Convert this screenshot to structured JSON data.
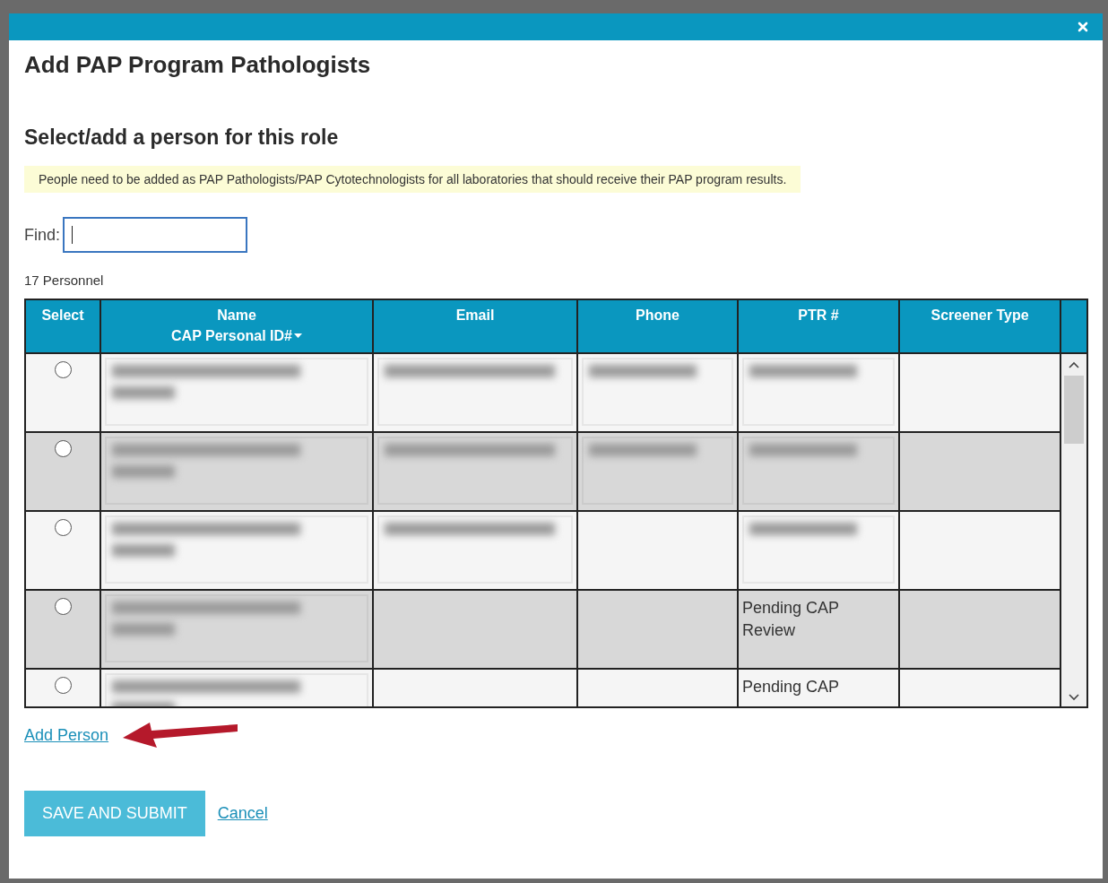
{
  "dialog": {
    "title": "Add PAP Program Pathologists"
  },
  "section_heading": "Select/add a person for this role",
  "notice": "People need to be added as PAP Pathologists/PAP Cytotechnologists for all laboratories that should receive their PAP program results.",
  "find": {
    "label": "Find:",
    "focused": true
  },
  "count": "17 Personnel",
  "table": {
    "columns": [
      {
        "label": "Select"
      },
      {
        "label": "Name",
        "sublabel": "CAP Personal ID#",
        "sorted": true
      },
      {
        "label": "Email"
      },
      {
        "label": "Phone"
      },
      {
        "label": "PTR #"
      },
      {
        "label": "Screener Type"
      }
    ],
    "rows": [
      {
        "selected": false,
        "cells": [
          {
            "kind": "redacted"
          },
          {
            "kind": "redacted"
          },
          {
            "kind": "redacted"
          },
          {
            "kind": "redacted"
          },
          null
        ]
      },
      {
        "selected": false,
        "cells": [
          {
            "kind": "redacted"
          },
          {
            "kind": "redacted"
          },
          {
            "kind": "redacted"
          },
          {
            "kind": "redacted"
          },
          null
        ]
      },
      {
        "selected": false,
        "cells": [
          {
            "kind": "redacted"
          },
          {
            "kind": "redacted"
          },
          null,
          {
            "kind": "redacted"
          },
          null
        ]
      },
      {
        "selected": false,
        "cells": [
          {
            "kind": "redacted"
          },
          null,
          null,
          {
            "kind": "text",
            "text": "Pending CAP Review"
          },
          null
        ]
      },
      {
        "selected": false,
        "cells": [
          {
            "kind": "redacted"
          },
          null,
          null,
          {
            "kind": "text",
            "text": "Pending CAP"
          },
          null
        ]
      }
    ]
  },
  "add_link": "Add Person",
  "buttons": [
    {
      "label": "SAVE AND SUBMIT",
      "kind": "primary"
    },
    {
      "label": "Cancel",
      "kind": "link"
    }
  ]
}
